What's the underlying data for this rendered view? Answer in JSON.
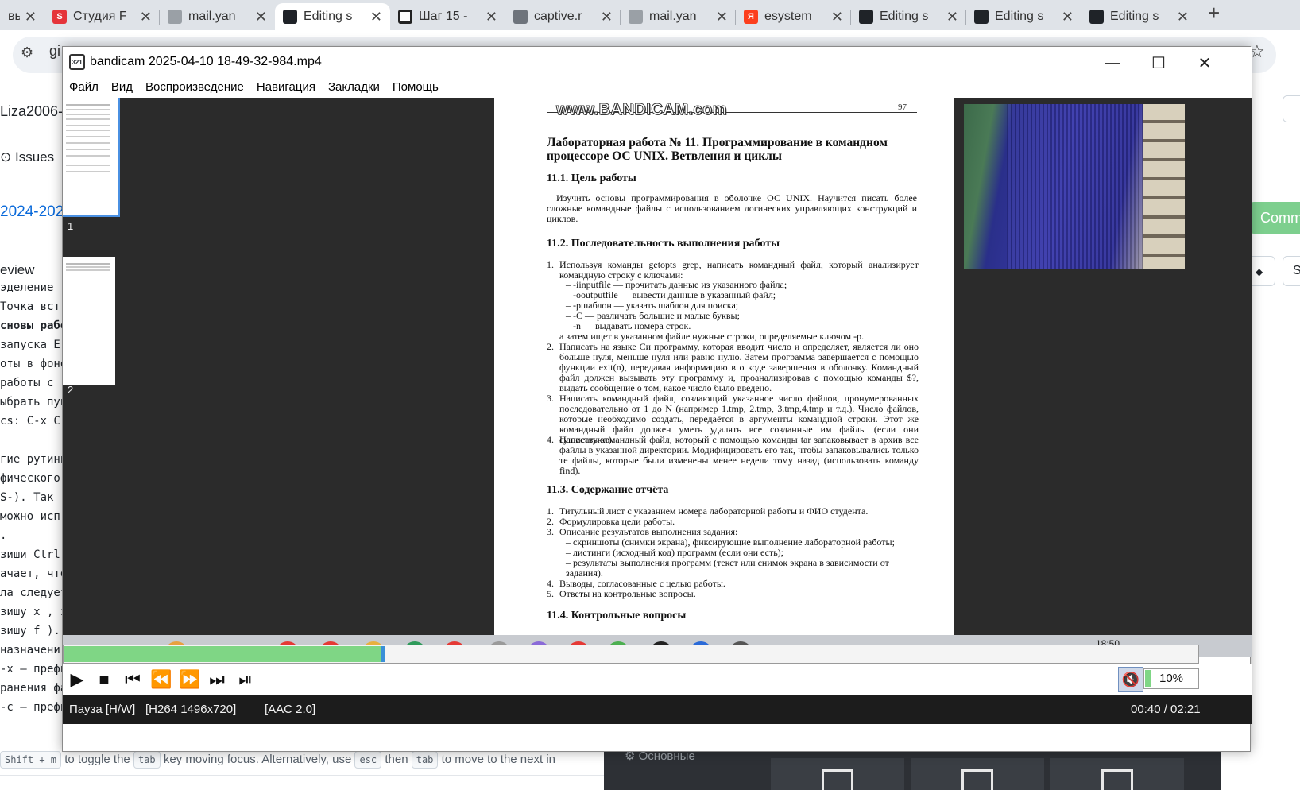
{
  "browser": {
    "tabs": [
      {
        "title": "вь",
        "icon": "partial-tab-icon"
      },
      {
        "title": "Студия F",
        "icon": "studio-icon"
      },
      {
        "title": "mail.yan",
        "icon": "mail-icon"
      },
      {
        "title": "Editing s",
        "icon": "github-icon",
        "active": true
      },
      {
        "title": "Шаг 15 -",
        "icon": "stepik-icon"
      },
      {
        "title": "captive.r",
        "icon": "captive-icon"
      },
      {
        "title": "mail.yan",
        "icon": "mail-icon"
      },
      {
        "title": "esystem",
        "icon": "yandex-icon"
      },
      {
        "title": "Editing s",
        "icon": "github-icon"
      },
      {
        "title": "Editing s",
        "icon": "github-icon"
      },
      {
        "title": "Editing s",
        "icon": "github-icon"
      }
    ],
    "omnibox_text": "gi"
  },
  "background_page": {
    "repo_fragment": "Liza2006-u",
    "issues_label": "Issues",
    "branch_fragment": "2024-202",
    "commit_fragment": "Comm",
    "preview_fragment": "eview",
    "select_fragment": "S",
    "code_lines": [
      "эделение",
      " Точка вст",
      "сновы рабо",
      " запуска E",
      "оты в фоно",
      " работы с",
      "ыбрать пун",
      "cs: C-x C-",
      "",
      "гие рутинн",
      "фического",
      " S-). Так",
      " можно исп",
      " .",
      "зиши Ctrl",
      "ачает, что",
      "ла следует",
      "зишу x , з",
      "зишу f ).",
      "назначени",
      "-x — префи",
      "ранения фа",
      "-c — префи"
    ],
    "hint": {
      "keys1": "Shift + m",
      "text1": "to toggle the",
      "key2": "tab",
      "text2": "key moving focus. Alternatively, use",
      "key3": "esc",
      "text3": "then",
      "key4": "tab",
      "text4": "to move to the next in"
    },
    "dark_panel_label": "Основные"
  },
  "player": {
    "title": "bandicam 2025-04-10 18-49-32-984.mp4",
    "menu": [
      "Файл",
      "Вид",
      "Воспроизведение",
      "Навигация",
      "Закладки",
      "Помощь"
    ],
    "thumb_pages": [
      "1",
      "2"
    ],
    "progress_percent": 28,
    "volume_label": "10%",
    "volume_fraction": 0.1,
    "status_state": "Пауза [H/W]",
    "status_video": "[H264 1496x720]",
    "status_audio": "[AAC 2.0]",
    "status_time": "00:40 / 02:21",
    "taskbar_clock": "18:50"
  },
  "document": {
    "watermark": "www.BANDICAM.com",
    "page_number": "97",
    "title": "Лабораторная работа № 11.   Программирование в командном процессоре ОС UNIX. Ветвления и циклы",
    "s1_heading": "11.1.   Цель работы",
    "s1_text": "Изучить основы программирования в оболочке ОС UNIX. Научится писать более сложные командные файлы с использованием логических управляющих конструкций и циклов.",
    "s2_heading": "11.2.   Последовательность выполнения работы",
    "task1": "Используя команды getopts grep, написать командный файл, который анализирует командную строку с ключами:",
    "task1_opts": [
      "–  -iinputfile — прочитать данные из указанного файла;",
      "–  -ooutputfile — вывести данные в указанный файл;",
      "–  -pшаблон — указать шаблон для поиска;",
      "–  -C — различать большие и малые буквы;",
      "–  -n — выдавать номера строк."
    ],
    "task1_tail": "а затем ищет в указанном файле нужные строки, определяемые ключом -p.",
    "task2": "Написать на языке Си программу, которая вводит число и определяет, является ли оно больше нуля, меньше нуля или равно нулю. Затем программа завершается с помощью функции exit(n), передавая информацию в о коде завершения в оболочку. Командный файл должен вызывать эту программу и, проанализировав с помощью команды $?, выдать сообщение о том, какое число было введено.",
    "task3": "Написать командный файл, создающий указанное число файлов, пронумерованных последовательно от 1 до N (например 1.tmp, 2.tmp, 3.tmp,4.tmp и т.д.). Число файлов, которые необходимо создать, передаётся в аргументы командной строки. Этот же командный файл должен уметь удалять все созданные им файлы (если они существуют).",
    "task4": "Написать командный файл, который с помощью команды tar запаковывает в архив все файлы в указанной директории. Модифицировать его так, чтобы запаковывались только те файлы, которые были изменены менее недели тому назад (использовать команду find).",
    "s3_heading": "11.3.   Содержание отчёта",
    "report": [
      "Титульный лист с указанием номера лабораторной работы и ФИО студента.",
      "Формулировка цели работы.",
      "Описание результатов выполнения задания:"
    ],
    "report_sub": [
      "–  скриншоты (снимки экрана), фиксирующие выполнение лабораторной работы;",
      "–  листинги (исходный код) программ (если они есть);",
      "–  результаты выполнения программ (текст или снимок экрана в зависимости от задания)."
    ],
    "report_tail": [
      "Выводы, согласованные с целью работы.",
      "Ответы на контрольные вопросы."
    ],
    "s4_heading": "11.4.   Контрольные вопросы"
  }
}
